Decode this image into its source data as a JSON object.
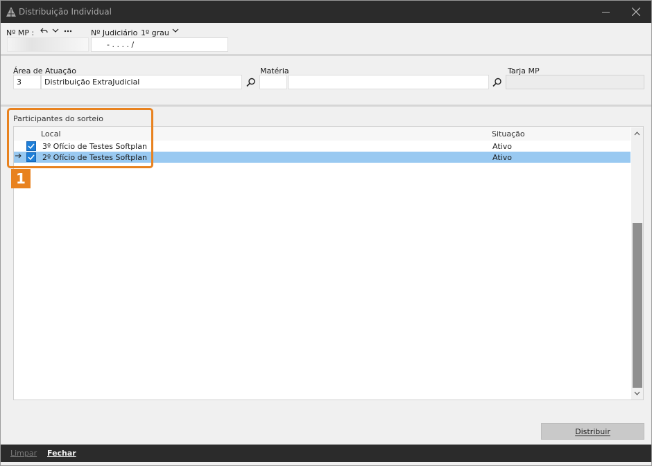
{
  "window": {
    "title": "Distribuição Individual",
    "minimize_icon": "minimize-icon",
    "close_icon": "close-icon"
  },
  "header": {
    "mp_label": "Nº MP :",
    "mp_value": "",
    "judiciario_label": "Nº Judiciário",
    "grau_value": "1º grau",
    "judiciario_value": "- .  . . .  /"
  },
  "filters": {
    "area_label": "Área de Atuação",
    "area_code": "3",
    "area_name": "Distribuição ExtraJudicial",
    "materia_label": "Matéria",
    "materia_code": "",
    "materia_name": "",
    "tarja_label": "Tarja MP",
    "tarja_value": ""
  },
  "participants": {
    "section_label": "Participantes do sorteio",
    "columns": {
      "local": "Local",
      "situacao": "Situação"
    },
    "rows": [
      {
        "local": "3º Ofício de Testes Softplan",
        "situacao": "Ativo",
        "checked": true,
        "selected": false
      },
      {
        "local": "2º Ofício de Testes Softplan",
        "situacao": "Ativo",
        "checked": true,
        "selected": true
      }
    ]
  },
  "annotation": {
    "badge_number": "1",
    "color": "#e8821f"
  },
  "actions": {
    "distribuir_label": "Distribuir",
    "limpar_label": "Limpar",
    "fechar_label": "Fechar"
  },
  "colors": {
    "titlebar": "#2b2b2b",
    "selection": "#99c9f1",
    "checkbox": "#1e7fd8"
  }
}
